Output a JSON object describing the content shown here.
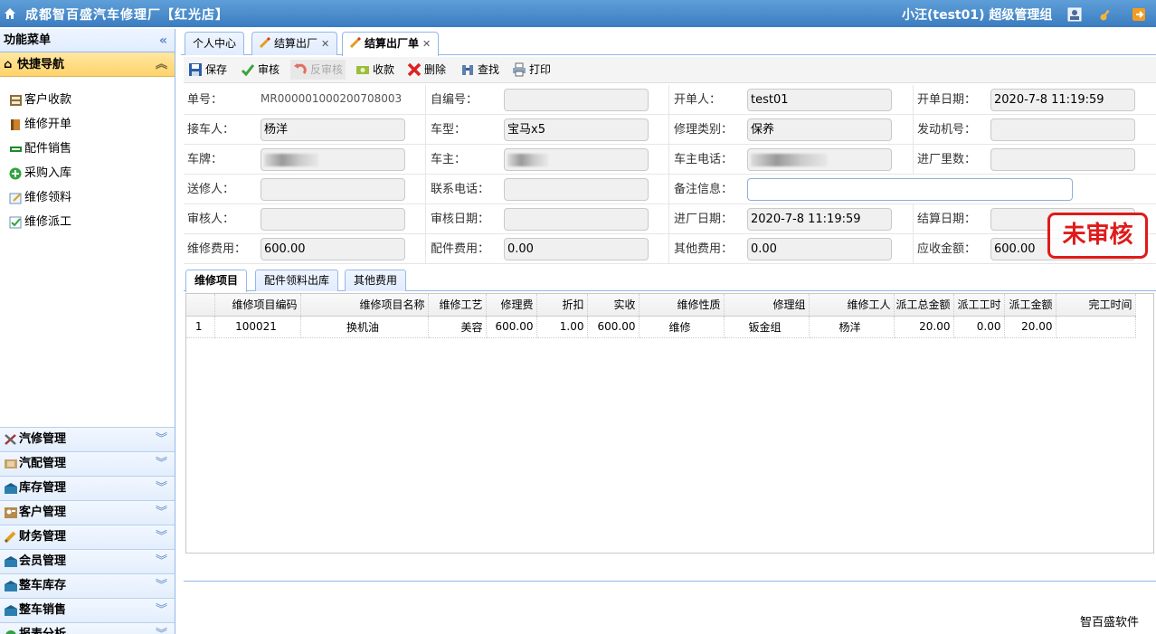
{
  "header": {
    "title": "成都智百盛汽车修理厂【红光店】",
    "user": "小汪(test01)  超级管理组"
  },
  "sidebar": {
    "menu_title": "功能菜单",
    "quick_nav": "快捷导航",
    "quick_items": [
      {
        "label": "客户收款",
        "icon": "cashier-icon"
      },
      {
        "label": "维修开单",
        "icon": "book-icon"
      },
      {
        "label": "配件销售",
        "icon": "minus-bar-icon"
      },
      {
        "label": "采购入库",
        "icon": "green-plus-icon"
      },
      {
        "label": "维修领料",
        "icon": "edit-note-icon"
      },
      {
        "label": "维修派工",
        "icon": "checklist-icon"
      }
    ],
    "groups": [
      {
        "label": "汽修管理",
        "icon": "tools-icon"
      },
      {
        "label": "汽配管理",
        "icon": "parts-icon"
      },
      {
        "label": "库存管理",
        "icon": "warehouse-icon"
      },
      {
        "label": "客户管理",
        "icon": "contact-card-icon"
      },
      {
        "label": "财务管理",
        "icon": "pencil-icon"
      },
      {
        "label": "会员管理",
        "icon": "member-icon"
      },
      {
        "label": "整车库存",
        "icon": "car-stock-icon"
      },
      {
        "label": "整车销售",
        "icon": "car-sale-icon"
      },
      {
        "label": "报表分析",
        "icon": "report-icon"
      }
    ]
  },
  "tabs": [
    {
      "label": "个人中心"
    },
    {
      "label": "结算出厂"
    },
    {
      "label": "结算出厂单"
    }
  ],
  "toolbar": {
    "save": "保存",
    "audit": "审核",
    "unaudit": "反审核",
    "collect": "收款",
    "delete": "删除",
    "find": "查找",
    "print": "打印"
  },
  "form": {
    "order_no_label": "单号：",
    "order_no": "MR000001000200708003",
    "self_no_label": "自编号：",
    "self_no": "",
    "issuer_label": "开单人：",
    "issuer": "test01",
    "open_date_label": "开单日期：",
    "open_date": "2020-7-8 11:19:59",
    "receiver_label": "接车人：",
    "receiver": "杨洋",
    "model_label": "车型：",
    "model": "宝马x5",
    "repair_type_label": "修理类别：",
    "repair_type": "保养",
    "engine_no_label": "发动机号：",
    "engine_no": "",
    "plate_label": "车牌：",
    "owner_label": "车主：",
    "owner_phone_label": "车主电话：",
    "mileage_label": "进厂里数：",
    "mileage": "",
    "sender_label": "送修人：",
    "sender": "",
    "contact_phone_label": "联系电话：",
    "contact_phone": "",
    "remark_label": "备注信息：",
    "remark": "",
    "auditor_label": "审核人：",
    "auditor": "",
    "audit_date_label": "审核日期：",
    "audit_date": "",
    "entry_date_label": "进厂日期：",
    "entry_date": "2020-7-8 11:19:59",
    "settle_date_label": "结算日期：",
    "settle_date": "",
    "repair_fee_label": "维修费用：",
    "repair_fee": "600.00",
    "parts_fee_label": "配件费用：",
    "parts_fee": "0.00",
    "other_fee_label": "其他费用：",
    "other_fee": "0.00",
    "receivable_label": "应收金额：",
    "receivable": "600.00",
    "status_stamp": "未审核"
  },
  "subtabs": [
    {
      "label": "维修项目"
    },
    {
      "label": "配件领料出库"
    },
    {
      "label": "其他费用"
    }
  ],
  "grid": {
    "columns": [
      "维修项目编码",
      "维修项目名称",
      "维修工艺",
      "修理费",
      "折扣",
      "实收",
      "维修性质",
      "修理组",
      "维修工人",
      "派工总金额",
      "派工工时",
      "派工金额",
      "完工时间"
    ],
    "rows": [
      {
        "no": "1",
        "cells": [
          "100021",
          "换机油",
          "美容",
          "600.00",
          "1.00",
          "600.00",
          "维修",
          "钣金组",
          "杨洋",
          "20.00",
          "0.00",
          "20.00",
          ""
        ]
      }
    ]
  },
  "footer": "智百盛软件",
  "colors": {
    "accent": "#3a7cc0",
    "stamp": "#e01a1a",
    "quick_nav_bg": "#ffd36a"
  }
}
